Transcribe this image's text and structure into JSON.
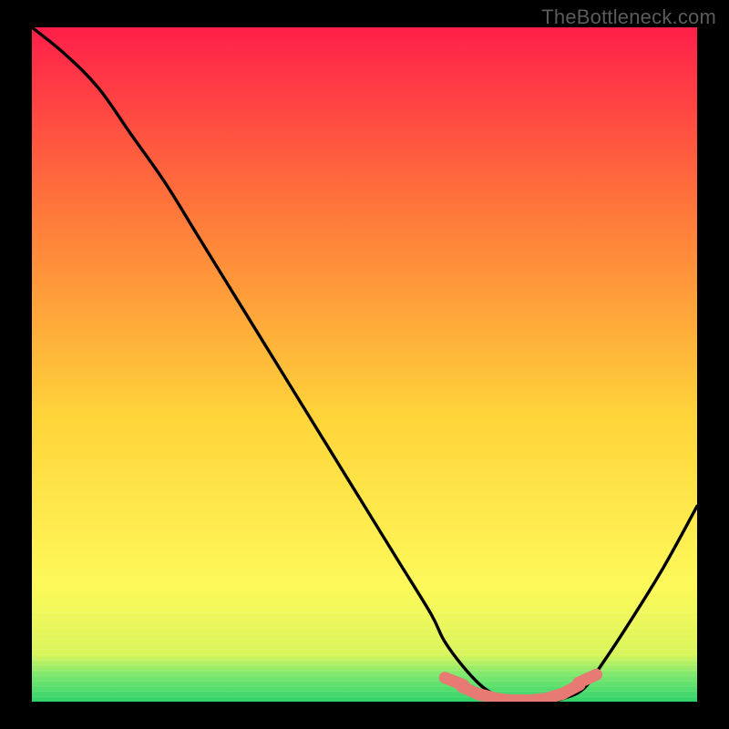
{
  "watermark": "TheBottleneck.com",
  "colors": {
    "black": "#000000",
    "curve": "#000000",
    "marker_fill": "#e77a72",
    "marker_stroke": "#c25b55",
    "grad_top": "#ff1f49",
    "grad_mid1": "#ff7a3a",
    "grad_mid2": "#ffd53a",
    "grad_low": "#fdf95a",
    "grad_green1": "#7de86e",
    "grad_green2": "#2fd36b"
  },
  "chart_data": {
    "type": "line",
    "title": "",
    "xlabel": "",
    "ylabel": "",
    "xlim": [
      0,
      100
    ],
    "ylim": [
      0,
      100
    ],
    "x": [
      0,
      5,
      10,
      15,
      20,
      25,
      30,
      35,
      40,
      45,
      50,
      55,
      60,
      62,
      65,
      68,
      71,
      74,
      77,
      80,
      83,
      86,
      90,
      95,
      100
    ],
    "values": [
      100,
      96,
      91,
      84,
      77,
      69,
      61,
      53,
      45,
      37,
      29,
      21,
      13,
      9,
      5,
      2,
      0.5,
      0,
      0,
      0.5,
      2,
      6,
      12,
      20,
      29
    ],
    "markers_x": [
      63.5,
      66,
      68.5,
      71,
      73.5,
      76,
      78.5,
      81,
      83.5
    ],
    "markers_y": [
      3.0,
      1.6,
      0.8,
      0.3,
      0.2,
      0.3,
      0.8,
      1.8,
      3.4
    ]
  }
}
